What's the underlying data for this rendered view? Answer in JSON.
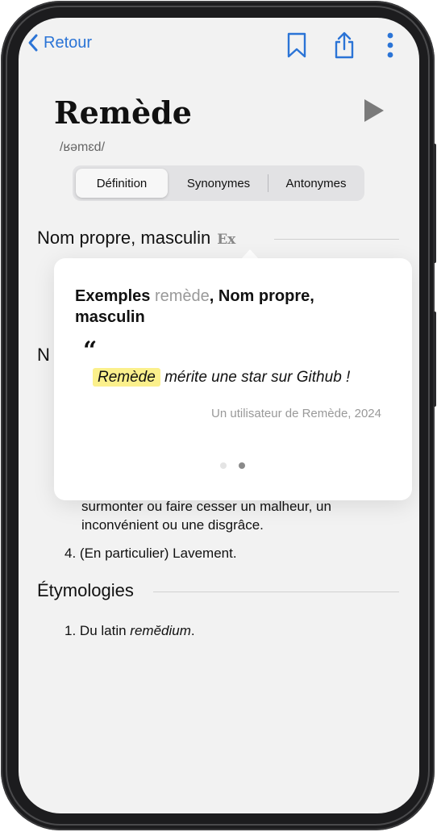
{
  "nav": {
    "back_label": "Retour"
  },
  "entry": {
    "word": "Remède",
    "phonetic": "/ʁəmɛd/"
  },
  "tabs": [
    {
      "label": "Définition",
      "selected": true
    },
    {
      "label": "Synonymes",
      "selected": false
    },
    {
      "label": "Antonymes",
      "selected": false
    }
  ],
  "sections": {
    "pos_title": "Nom propre, masculin",
    "examples_tag": "Ex",
    "partial_heading": "N",
    "definition_3_line1": "surmonter ou faire cesser un malheur, un",
    "definition_3_line2": "inconvénient ou une disgrâce.",
    "definition_4_number": "4.",
    "definition_4_text": "(En particulier) Lavement.",
    "etymology_title": "Étymologies",
    "etymology_number": "1.",
    "etymology_prefix": "Du latin ",
    "etymology_italic": "remĕdium",
    "etymology_suffix": "."
  },
  "popover": {
    "title_prefix": "Exemples ",
    "title_word": "remède",
    "title_suffix": ", Nom propre,",
    "title_line2": "masculin",
    "quote_mark": "“",
    "quote_highlight": "Remède",
    "quote_rest": " mérite une star sur Github !",
    "attribution": "Un utilisateur de Remède, 2024",
    "page_index": 2,
    "page_count": 2
  },
  "colors": {
    "accent": "#2b74d6",
    "highlight": "#fbf08c",
    "icon_gray": "#7a7a7a"
  },
  "icons": [
    "chevron-left-icon",
    "bookmark-icon",
    "share-icon",
    "more-vertical-icon",
    "play-icon"
  ]
}
